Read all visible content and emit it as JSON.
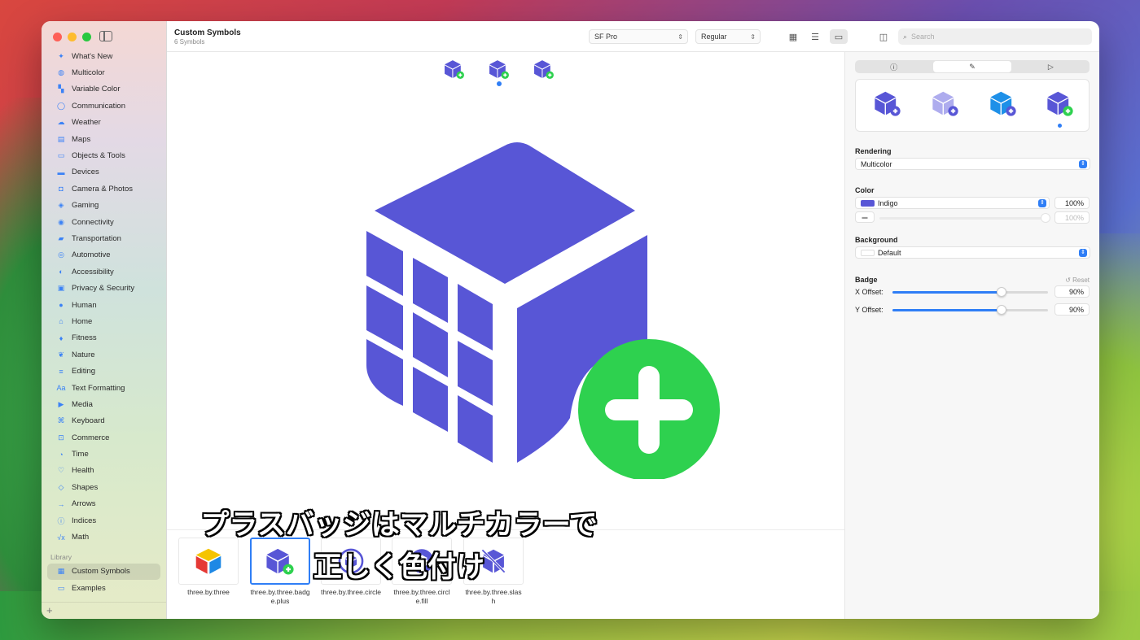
{
  "window": {
    "title": "Custom Symbols",
    "subtitle": "6 Symbols"
  },
  "toolbar": {
    "font_popup": "SF Pro",
    "weight_popup": "Regular",
    "search_placeholder": "Search"
  },
  "sidebar": {
    "items": [
      {
        "label": "What's New",
        "icon": "sparkle-icon",
        "glyph": "✦"
      },
      {
        "label": "Multicolor",
        "icon": "paintpalette-icon",
        "glyph": "◍"
      },
      {
        "label": "Variable Color",
        "icon": "variable-color-icon",
        "glyph": "▚"
      },
      {
        "label": "Communication",
        "icon": "message-icon",
        "glyph": "◯"
      },
      {
        "label": "Weather",
        "icon": "cloud-sun-icon",
        "glyph": "☁"
      },
      {
        "label": "Maps",
        "icon": "map-icon",
        "glyph": "▤"
      },
      {
        "label": "Objects & Tools",
        "icon": "folder-icon",
        "glyph": "▭"
      },
      {
        "label": "Devices",
        "icon": "desktop-icon",
        "glyph": "▬"
      },
      {
        "label": "Camera & Photos",
        "icon": "camera-icon",
        "glyph": "◘"
      },
      {
        "label": "Gaming",
        "icon": "gamecontroller-icon",
        "glyph": "◈"
      },
      {
        "label": "Connectivity",
        "icon": "antenna-icon",
        "glyph": "◉"
      },
      {
        "label": "Transportation",
        "icon": "car-icon",
        "glyph": "▰"
      },
      {
        "label": "Automotive",
        "icon": "steeringwheel-icon",
        "glyph": "◎"
      },
      {
        "label": "Accessibility",
        "icon": "accessibility-icon",
        "glyph": "◐"
      },
      {
        "label": "Privacy & Security",
        "icon": "lock-icon",
        "glyph": "▣"
      },
      {
        "label": "Human",
        "icon": "person-icon",
        "glyph": "●"
      },
      {
        "label": "Home",
        "icon": "house-icon",
        "glyph": "⌂"
      },
      {
        "label": "Fitness",
        "icon": "figure-run-icon",
        "glyph": "♦"
      },
      {
        "label": "Nature",
        "icon": "leaf-icon",
        "glyph": "❦"
      },
      {
        "label": "Editing",
        "icon": "slider-icon",
        "glyph": "≡"
      },
      {
        "label": "Text Formatting",
        "icon": "textformat-icon",
        "glyph": "Aa"
      },
      {
        "label": "Media",
        "icon": "playpause-icon",
        "glyph": "▶"
      },
      {
        "label": "Keyboard",
        "icon": "command-icon",
        "glyph": "⌘"
      },
      {
        "label": "Commerce",
        "icon": "cart-icon",
        "glyph": "⊡"
      },
      {
        "label": "Time",
        "icon": "clock-icon",
        "glyph": "◔"
      },
      {
        "label": "Health",
        "icon": "heart-icon",
        "glyph": "♡"
      },
      {
        "label": "Shapes",
        "icon": "shapes-icon",
        "glyph": "◇"
      },
      {
        "label": "Arrows",
        "icon": "arrow-right-icon",
        "glyph": "→"
      },
      {
        "label": "Indices",
        "icon": "info-circle-icon",
        "glyph": "ⓘ"
      },
      {
        "label": "Math",
        "icon": "function-icon",
        "glyph": "√x"
      }
    ],
    "library_header": "Library",
    "library": [
      {
        "label": "Custom Symbols",
        "icon": "grid-icon",
        "glyph": "▦",
        "selected": true
      },
      {
        "label": "Examples",
        "icon": "folder-icon",
        "glyph": "▭",
        "selected": false
      }
    ],
    "add_label": "+"
  },
  "gallery": {
    "items": [
      {
        "label": "three.by.three"
      },
      {
        "label": "three.by.three.badge.plus"
      },
      {
        "label": "three.by.three.circle"
      },
      {
        "label": "three.by.three.circle.fill"
      },
      {
        "label": "three.by.three.slash"
      }
    ]
  },
  "subtitle_overlay": {
    "line1": "プラスバッジはマルチカラーで",
    "line2": "正しく色付け"
  },
  "inspector": {
    "rendering_label": "Rendering",
    "rendering_value": "Multicolor",
    "color_label": "Color",
    "color_value": "Indigo",
    "color_opacity": "100%",
    "secondary_opacity": "100%",
    "background_label": "Background",
    "background_value": "Default",
    "badge_label": "Badge",
    "reset_label": "Reset",
    "x_offset_label": "X Offset:",
    "x_offset_value": "90%",
    "y_offset_label": "Y Offset:",
    "y_offset_value": "90%"
  },
  "colors": {
    "indigo": "#5856d6",
    "badge_green": "#2ed14f",
    "accent": "#2f7ef6"
  }
}
